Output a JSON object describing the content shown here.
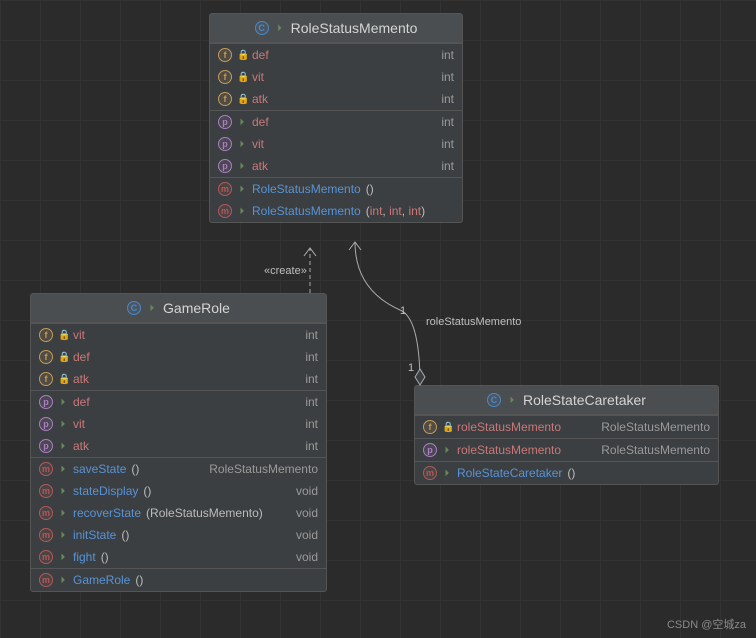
{
  "watermark": "CSDN @空城za",
  "relations": {
    "create_label": "«create»",
    "assoc_label": "roleStatusMemento",
    "mult_top": "1",
    "mult_bottom": "1"
  },
  "classes": {
    "memento": {
      "title": "RoleStatusMemento",
      "fields": [
        {
          "name": "def",
          "type": "int",
          "vis": "private"
        },
        {
          "name": "vit",
          "type": "int",
          "vis": "private"
        },
        {
          "name": "atk",
          "type": "int",
          "vis": "private"
        }
      ],
      "props": [
        {
          "name": "def",
          "type": "int",
          "vis": "public"
        },
        {
          "name": "vit",
          "type": "int",
          "vis": "public"
        },
        {
          "name": "atk",
          "type": "int",
          "vis": "public"
        }
      ],
      "methods": [
        {
          "name": "RoleStatusMemento",
          "params": "()",
          "ret": ""
        },
        {
          "name": "RoleStatusMemento",
          "params": "(int, int, int)",
          "ret": "",
          "typed": true
        }
      ]
    },
    "gamerole": {
      "title": "GameRole",
      "fields": [
        {
          "name": "vit",
          "type": "int",
          "vis": "private"
        },
        {
          "name": "def",
          "type": "int",
          "vis": "private"
        },
        {
          "name": "atk",
          "type": "int",
          "vis": "private"
        }
      ],
      "props": [
        {
          "name": "def",
          "type": "int",
          "vis": "public"
        },
        {
          "name": "vit",
          "type": "int",
          "vis": "public"
        },
        {
          "name": "atk",
          "type": "int",
          "vis": "public"
        }
      ],
      "methods": [
        {
          "name": "saveState",
          "params": "()",
          "ret": "RoleStatusMemento"
        },
        {
          "name": "stateDisplay",
          "params": "()",
          "ret": "void"
        },
        {
          "name": "recoverState",
          "params": "(RoleStatusMemento)",
          "ret": "void"
        },
        {
          "name": "initState",
          "params": "()",
          "ret": "void"
        },
        {
          "name": "fight",
          "params": "()",
          "ret": "void"
        }
      ],
      "ctors": [
        {
          "name": "GameRole",
          "params": "()",
          "ret": ""
        }
      ]
    },
    "caretaker": {
      "title": "RoleStateCaretaker",
      "fields": [
        {
          "name": "roleStatusMemento",
          "type": "RoleStatusMemento",
          "vis": "private"
        }
      ],
      "props": [
        {
          "name": "roleStatusMemento",
          "type": "RoleStatusMemento",
          "vis": "public"
        }
      ],
      "methods": [
        {
          "name": "RoleStateCaretaker",
          "params": "()",
          "ret": ""
        }
      ]
    }
  }
}
